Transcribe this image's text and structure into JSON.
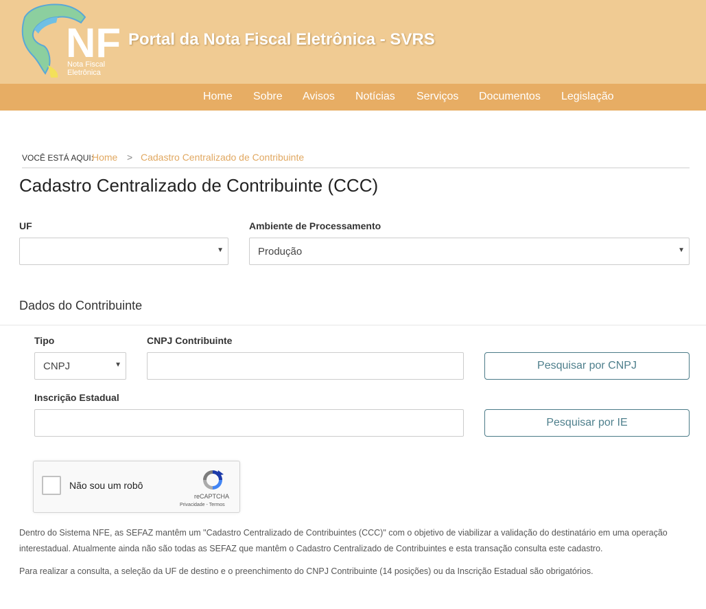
{
  "header": {
    "logo_text": "NFe",
    "logo_subtitle_1": "Nota Fiscal",
    "logo_subtitle_2": "Eletrônica",
    "portal_title": "Portal da Nota Fiscal Eletrônica - SVRS"
  },
  "nav": {
    "items": [
      "Home",
      "Sobre",
      "Avisos",
      "Notícias",
      "Serviços",
      "Documentos",
      "Legislação"
    ]
  },
  "breadcrumb": {
    "label": "VOCÊ ESTÁ AQUI:",
    "home": "Home",
    "separator": ">",
    "current": "Cadastro Centralizado de Contribuinte"
  },
  "page_title": "Cadastro Centralizado de Contribuinte (CCC)",
  "form": {
    "uf_label": "UF",
    "uf_value": "",
    "ambiente_label": "Ambiente de Processamento",
    "ambiente_value": "Produção",
    "section_title": "Dados do Contribuinte",
    "tipo_label": "Tipo",
    "tipo_value": "CNPJ",
    "cnpj_label": "CNPJ Contribuinte",
    "cnpj_value": "",
    "ie_label": "Inscrição Estadual",
    "ie_value": "",
    "btn_cnpj": "Pesquisar por CNPJ",
    "btn_ie": "Pesquisar por IE"
  },
  "captcha": {
    "label": "Não sou um robô",
    "brand": "reCAPTCHA",
    "privacy": "Privacidade",
    "link_sep": " - ",
    "terms": "Termos"
  },
  "info": {
    "paragraph_1": "Dentro do Sistema NFE, as SEFAZ mantêm um \"Cadastro Centralizado de Contribuintes (CCC)\" com o objetivo de viabilizar a validação do destinatário em uma operação interestadual. Atualmente ainda não são todas as SEFAZ que mantêm o Cadastro Centralizado de Contribuintes e esta transação consulta este cadastro.",
    "paragraph_2": "Para realizar a consulta, a seleção da UF de destino e o preenchimento do CNPJ Contribuinte (14 posições) ou da Inscrição Estadual são obrigatórios."
  },
  "colors": {
    "header_bg": "#f0cb93",
    "nav_bg": "#e7ad64",
    "link": "#e1a861",
    "button_text": "#4e7f8c"
  },
  "icons": {
    "logo": "brazil-map-logo-icon",
    "caret": "caret-down-icon",
    "captcha": "recaptcha-logo-icon"
  }
}
